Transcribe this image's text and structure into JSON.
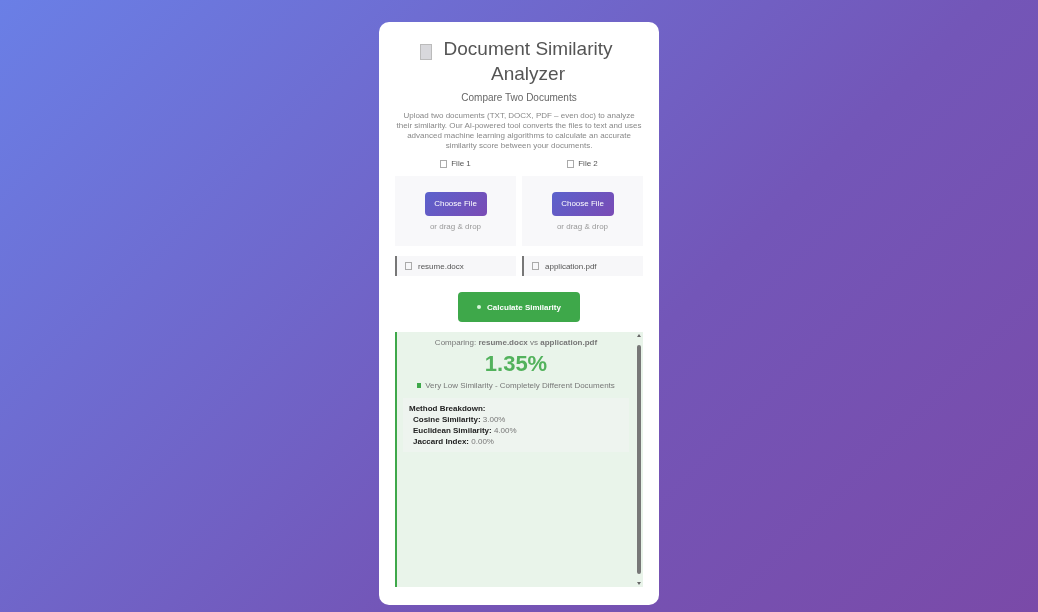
{
  "header": {
    "title": "Document Similarity Analyzer",
    "subtitle": "Compare Two Documents",
    "description": "Upload two documents (TXT, DOCX, PDF – even doc) to analyze their similarity. Our AI-powered tool converts the files to text and uses advanced machine learning algorithms to calculate an accurate similarity score between your documents."
  },
  "files": [
    {
      "label": "File 1",
      "button": "Choose File",
      "hint": "or drag & drop",
      "filename": "resume.docx"
    },
    {
      "label": "File 2",
      "button": "Choose File",
      "hint": "or drag & drop",
      "filename": "application.pdf"
    }
  ],
  "calculate_button": "Calculate Similarity",
  "result": {
    "comparing": "Comparing: **resume.docx** vs **application.pdf**",
    "score": "1.35%",
    "verdict": "Very Low Similarity - Completely Different Documents",
    "breakdown_title": "Method Breakdown:",
    "methods": [
      {
        "name": "Cosine Similarity:",
        "value": "3.00%"
      },
      {
        "name": "Euclidean Similarity:",
        "value": "4.00%"
      },
      {
        "name": "Jaccard Index:",
        "value": "0.00%"
      }
    ]
  }
}
